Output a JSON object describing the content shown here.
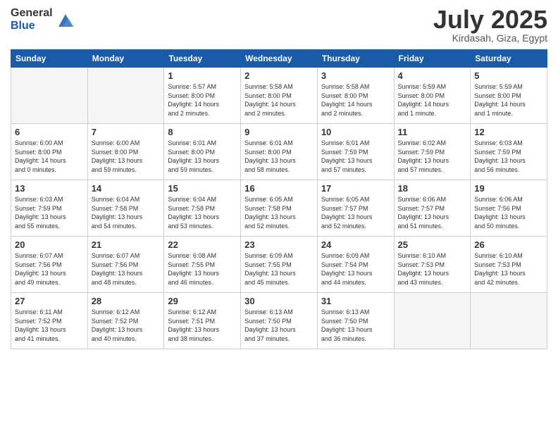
{
  "logo": {
    "general": "General",
    "blue": "Blue"
  },
  "title": "July 2025",
  "location": "Kirdasah, Giza, Egypt",
  "weekdays": [
    "Sunday",
    "Monday",
    "Tuesday",
    "Wednesday",
    "Thursday",
    "Friday",
    "Saturday"
  ],
  "weeks": [
    [
      {
        "day": "",
        "info": ""
      },
      {
        "day": "",
        "info": ""
      },
      {
        "day": "1",
        "info": "Sunrise: 5:57 AM\nSunset: 8:00 PM\nDaylight: 14 hours\nand 2 minutes."
      },
      {
        "day": "2",
        "info": "Sunrise: 5:58 AM\nSunset: 8:00 PM\nDaylight: 14 hours\nand 2 minutes."
      },
      {
        "day": "3",
        "info": "Sunrise: 5:58 AM\nSunset: 8:00 PM\nDaylight: 14 hours\nand 2 minutes."
      },
      {
        "day": "4",
        "info": "Sunrise: 5:59 AM\nSunset: 8:00 PM\nDaylight: 14 hours\nand 1 minute."
      },
      {
        "day": "5",
        "info": "Sunrise: 5:59 AM\nSunset: 8:00 PM\nDaylight: 14 hours\nand 1 minute."
      }
    ],
    [
      {
        "day": "6",
        "info": "Sunrise: 6:00 AM\nSunset: 8:00 PM\nDaylight: 14 hours\nand 0 minutes."
      },
      {
        "day": "7",
        "info": "Sunrise: 6:00 AM\nSunset: 8:00 PM\nDaylight: 13 hours\nand 59 minutes."
      },
      {
        "day": "8",
        "info": "Sunrise: 6:01 AM\nSunset: 8:00 PM\nDaylight: 13 hours\nand 59 minutes."
      },
      {
        "day": "9",
        "info": "Sunrise: 6:01 AM\nSunset: 8:00 PM\nDaylight: 13 hours\nand 58 minutes."
      },
      {
        "day": "10",
        "info": "Sunrise: 6:01 AM\nSunset: 7:59 PM\nDaylight: 13 hours\nand 57 minutes."
      },
      {
        "day": "11",
        "info": "Sunrise: 6:02 AM\nSunset: 7:59 PM\nDaylight: 13 hours\nand 57 minutes."
      },
      {
        "day": "12",
        "info": "Sunrise: 6:03 AM\nSunset: 7:59 PM\nDaylight: 13 hours\nand 56 minutes."
      }
    ],
    [
      {
        "day": "13",
        "info": "Sunrise: 6:03 AM\nSunset: 7:59 PM\nDaylight: 13 hours\nand 55 minutes."
      },
      {
        "day": "14",
        "info": "Sunrise: 6:04 AM\nSunset: 7:58 PM\nDaylight: 13 hours\nand 54 minutes."
      },
      {
        "day": "15",
        "info": "Sunrise: 6:04 AM\nSunset: 7:58 PM\nDaylight: 13 hours\nand 53 minutes."
      },
      {
        "day": "16",
        "info": "Sunrise: 6:05 AM\nSunset: 7:58 PM\nDaylight: 13 hours\nand 52 minutes."
      },
      {
        "day": "17",
        "info": "Sunrise: 6:05 AM\nSunset: 7:57 PM\nDaylight: 13 hours\nand 52 minutes."
      },
      {
        "day": "18",
        "info": "Sunrise: 6:06 AM\nSunset: 7:57 PM\nDaylight: 13 hours\nand 51 minutes."
      },
      {
        "day": "19",
        "info": "Sunrise: 6:06 AM\nSunset: 7:56 PM\nDaylight: 13 hours\nand 50 minutes."
      }
    ],
    [
      {
        "day": "20",
        "info": "Sunrise: 6:07 AM\nSunset: 7:56 PM\nDaylight: 13 hours\nand 49 minutes."
      },
      {
        "day": "21",
        "info": "Sunrise: 6:07 AM\nSunset: 7:56 PM\nDaylight: 13 hours\nand 48 minutes."
      },
      {
        "day": "22",
        "info": "Sunrise: 6:08 AM\nSunset: 7:55 PM\nDaylight: 13 hours\nand 46 minutes."
      },
      {
        "day": "23",
        "info": "Sunrise: 6:09 AM\nSunset: 7:55 PM\nDaylight: 13 hours\nand 45 minutes."
      },
      {
        "day": "24",
        "info": "Sunrise: 6:09 AM\nSunset: 7:54 PM\nDaylight: 13 hours\nand 44 minutes."
      },
      {
        "day": "25",
        "info": "Sunrise: 6:10 AM\nSunset: 7:53 PM\nDaylight: 13 hours\nand 43 minutes."
      },
      {
        "day": "26",
        "info": "Sunrise: 6:10 AM\nSunset: 7:53 PM\nDaylight: 13 hours\nand 42 minutes."
      }
    ],
    [
      {
        "day": "27",
        "info": "Sunrise: 6:11 AM\nSunset: 7:52 PM\nDaylight: 13 hours\nand 41 minutes."
      },
      {
        "day": "28",
        "info": "Sunrise: 6:12 AM\nSunset: 7:52 PM\nDaylight: 13 hours\nand 40 minutes."
      },
      {
        "day": "29",
        "info": "Sunrise: 6:12 AM\nSunset: 7:51 PM\nDaylight: 13 hours\nand 38 minutes."
      },
      {
        "day": "30",
        "info": "Sunrise: 6:13 AM\nSunset: 7:50 PM\nDaylight: 13 hours\nand 37 minutes."
      },
      {
        "day": "31",
        "info": "Sunrise: 6:13 AM\nSunset: 7:50 PM\nDaylight: 13 hours\nand 36 minutes."
      },
      {
        "day": "",
        "info": ""
      },
      {
        "day": "",
        "info": ""
      }
    ]
  ]
}
